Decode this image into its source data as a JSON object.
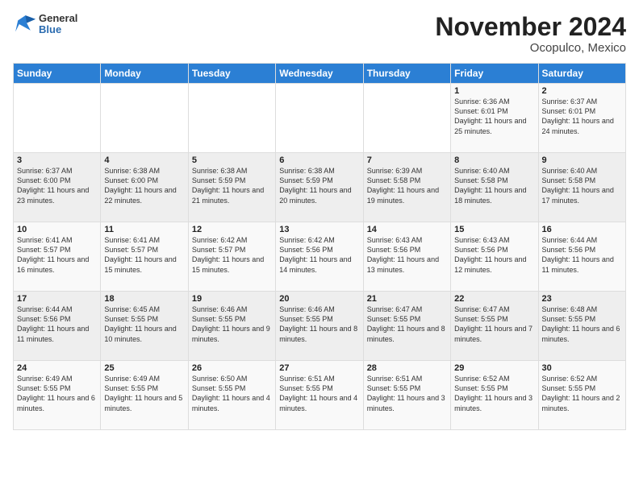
{
  "header": {
    "logo_general": "General",
    "logo_blue": "Blue",
    "month_title": "November 2024",
    "location": "Ocopulco, Mexico"
  },
  "weekdays": [
    "Sunday",
    "Monday",
    "Tuesday",
    "Wednesday",
    "Thursday",
    "Friday",
    "Saturday"
  ],
  "weeks": [
    [
      {
        "day": "",
        "info": ""
      },
      {
        "day": "",
        "info": ""
      },
      {
        "day": "",
        "info": ""
      },
      {
        "day": "",
        "info": ""
      },
      {
        "day": "",
        "info": ""
      },
      {
        "day": "1",
        "info": "Sunrise: 6:36 AM\nSunset: 6:01 PM\nDaylight: 11 hours and 25 minutes."
      },
      {
        "day": "2",
        "info": "Sunrise: 6:37 AM\nSunset: 6:01 PM\nDaylight: 11 hours and 24 minutes."
      }
    ],
    [
      {
        "day": "3",
        "info": "Sunrise: 6:37 AM\nSunset: 6:00 PM\nDaylight: 11 hours and 23 minutes."
      },
      {
        "day": "4",
        "info": "Sunrise: 6:38 AM\nSunset: 6:00 PM\nDaylight: 11 hours and 22 minutes."
      },
      {
        "day": "5",
        "info": "Sunrise: 6:38 AM\nSunset: 5:59 PM\nDaylight: 11 hours and 21 minutes."
      },
      {
        "day": "6",
        "info": "Sunrise: 6:38 AM\nSunset: 5:59 PM\nDaylight: 11 hours and 20 minutes."
      },
      {
        "day": "7",
        "info": "Sunrise: 6:39 AM\nSunset: 5:58 PM\nDaylight: 11 hours and 19 minutes."
      },
      {
        "day": "8",
        "info": "Sunrise: 6:40 AM\nSunset: 5:58 PM\nDaylight: 11 hours and 18 minutes."
      },
      {
        "day": "9",
        "info": "Sunrise: 6:40 AM\nSunset: 5:58 PM\nDaylight: 11 hours and 17 minutes."
      }
    ],
    [
      {
        "day": "10",
        "info": "Sunrise: 6:41 AM\nSunset: 5:57 PM\nDaylight: 11 hours and 16 minutes."
      },
      {
        "day": "11",
        "info": "Sunrise: 6:41 AM\nSunset: 5:57 PM\nDaylight: 11 hours and 15 minutes."
      },
      {
        "day": "12",
        "info": "Sunrise: 6:42 AM\nSunset: 5:57 PM\nDaylight: 11 hours and 15 minutes."
      },
      {
        "day": "13",
        "info": "Sunrise: 6:42 AM\nSunset: 5:56 PM\nDaylight: 11 hours and 14 minutes."
      },
      {
        "day": "14",
        "info": "Sunrise: 6:43 AM\nSunset: 5:56 PM\nDaylight: 11 hours and 13 minutes."
      },
      {
        "day": "15",
        "info": "Sunrise: 6:43 AM\nSunset: 5:56 PM\nDaylight: 11 hours and 12 minutes."
      },
      {
        "day": "16",
        "info": "Sunrise: 6:44 AM\nSunset: 5:56 PM\nDaylight: 11 hours and 11 minutes."
      }
    ],
    [
      {
        "day": "17",
        "info": "Sunrise: 6:44 AM\nSunset: 5:56 PM\nDaylight: 11 hours and 11 minutes."
      },
      {
        "day": "18",
        "info": "Sunrise: 6:45 AM\nSunset: 5:55 PM\nDaylight: 11 hours and 10 minutes."
      },
      {
        "day": "19",
        "info": "Sunrise: 6:46 AM\nSunset: 5:55 PM\nDaylight: 11 hours and 9 minutes."
      },
      {
        "day": "20",
        "info": "Sunrise: 6:46 AM\nSunset: 5:55 PM\nDaylight: 11 hours and 8 minutes."
      },
      {
        "day": "21",
        "info": "Sunrise: 6:47 AM\nSunset: 5:55 PM\nDaylight: 11 hours and 8 minutes."
      },
      {
        "day": "22",
        "info": "Sunrise: 6:47 AM\nSunset: 5:55 PM\nDaylight: 11 hours and 7 minutes."
      },
      {
        "day": "23",
        "info": "Sunrise: 6:48 AM\nSunset: 5:55 PM\nDaylight: 11 hours and 6 minutes."
      }
    ],
    [
      {
        "day": "24",
        "info": "Sunrise: 6:49 AM\nSunset: 5:55 PM\nDaylight: 11 hours and 6 minutes."
      },
      {
        "day": "25",
        "info": "Sunrise: 6:49 AM\nSunset: 5:55 PM\nDaylight: 11 hours and 5 minutes."
      },
      {
        "day": "26",
        "info": "Sunrise: 6:50 AM\nSunset: 5:55 PM\nDaylight: 11 hours and 4 minutes."
      },
      {
        "day": "27",
        "info": "Sunrise: 6:51 AM\nSunset: 5:55 PM\nDaylight: 11 hours and 4 minutes."
      },
      {
        "day": "28",
        "info": "Sunrise: 6:51 AM\nSunset: 5:55 PM\nDaylight: 11 hours and 3 minutes."
      },
      {
        "day": "29",
        "info": "Sunrise: 6:52 AM\nSunset: 5:55 PM\nDaylight: 11 hours and 3 minutes."
      },
      {
        "day": "30",
        "info": "Sunrise: 6:52 AM\nSunset: 5:55 PM\nDaylight: 11 hours and 2 minutes."
      }
    ]
  ]
}
